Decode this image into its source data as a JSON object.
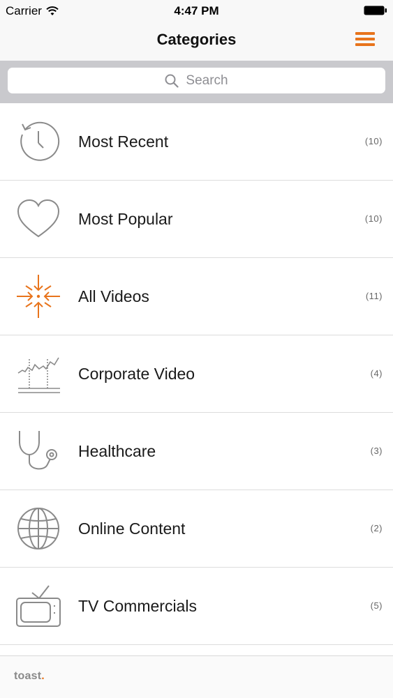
{
  "status_bar": {
    "carrier": "Carrier",
    "time": "4:47 PM"
  },
  "nav": {
    "title": "Categories"
  },
  "search": {
    "placeholder": "Search"
  },
  "categories": [
    {
      "label": "Most Recent",
      "count": "(10)",
      "icon": "clock-history-icon"
    },
    {
      "label": "Most Popular",
      "count": "(10)",
      "icon": "heart-icon"
    },
    {
      "label": "All Videos",
      "count": "(11)",
      "icon": "converge-arrows-icon"
    },
    {
      "label": "Corporate Video",
      "count": "(4)",
      "icon": "line-chart-icon"
    },
    {
      "label": "Healthcare",
      "count": "(3)",
      "icon": "stethoscope-icon"
    },
    {
      "label": "Online Content",
      "count": "(2)",
      "icon": "globe-icon"
    },
    {
      "label": "TV Commercials",
      "count": "(5)",
      "icon": "tv-icon"
    }
  ],
  "footer": {
    "logo_text": "toast",
    "logo_dot": "."
  },
  "colors": {
    "accent": "#e8741c",
    "icon_gray": "#8a8a8a"
  }
}
